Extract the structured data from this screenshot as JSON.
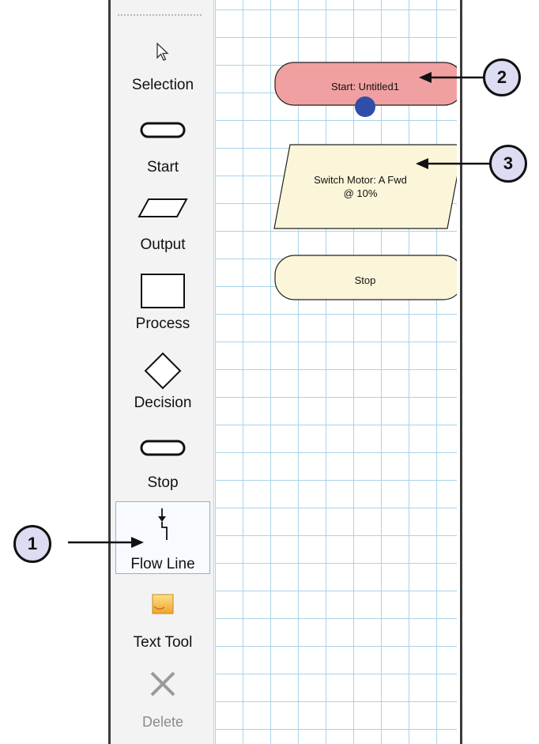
{
  "toolbox": {
    "tools": [
      {
        "label": "Selection",
        "icon": "pointer-arrow-icon"
      },
      {
        "label": "Start",
        "icon": "terminator-shape-icon"
      },
      {
        "label": "Output",
        "icon": "parallelogram-shape-icon"
      },
      {
        "label": "Process",
        "icon": "rectangle-shape-icon"
      },
      {
        "label": "Decision",
        "icon": "diamond-shape-icon"
      },
      {
        "label": "Stop",
        "icon": "terminator-shape-icon"
      },
      {
        "label": "Flow Line",
        "icon": "flow-line-icon",
        "selected": true
      },
      {
        "label": "Text Tool",
        "icon": "text-tool-icon"
      },
      {
        "label": "Delete",
        "icon": "delete-x-icon",
        "disabled": true
      }
    ]
  },
  "flowchart": {
    "start_label": "Start: Untitled1",
    "output_label_line1": "Switch Motor: A Fwd",
    "output_label_line2": "@ 10%",
    "stop_label": "Stop",
    "colors": {
      "start_fill": "#f0a0a0",
      "block_fill": "#fbf6d9",
      "connector_dot": "#2f4ea8",
      "grid_line": "#a9d4e8"
    }
  },
  "callouts": [
    "1",
    "2",
    "3"
  ]
}
